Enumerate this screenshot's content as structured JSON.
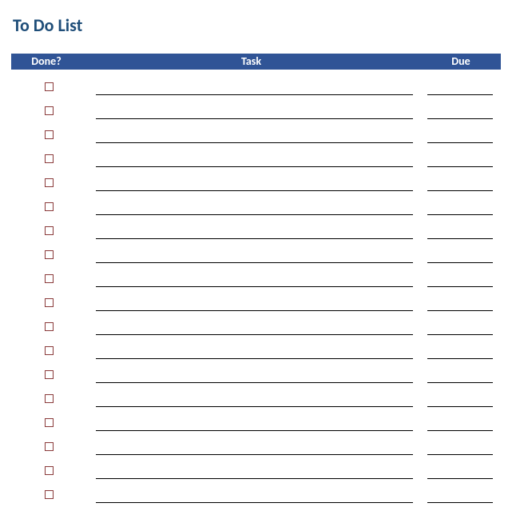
{
  "title": "To Do List",
  "columns": {
    "done": "Done?",
    "task": "Task",
    "due": "Due"
  },
  "rows": [
    {
      "done": false,
      "task": "",
      "due": ""
    },
    {
      "done": false,
      "task": "",
      "due": ""
    },
    {
      "done": false,
      "task": "",
      "due": ""
    },
    {
      "done": false,
      "task": "",
      "due": ""
    },
    {
      "done": false,
      "task": "",
      "due": ""
    },
    {
      "done": false,
      "task": "",
      "due": ""
    },
    {
      "done": false,
      "task": "",
      "due": ""
    },
    {
      "done": false,
      "task": "",
      "due": ""
    },
    {
      "done": false,
      "task": "",
      "due": ""
    },
    {
      "done": false,
      "task": "",
      "due": ""
    },
    {
      "done": false,
      "task": "",
      "due": ""
    },
    {
      "done": false,
      "task": "",
      "due": ""
    },
    {
      "done": false,
      "task": "",
      "due": ""
    },
    {
      "done": false,
      "task": "",
      "due": ""
    },
    {
      "done": false,
      "task": "",
      "due": ""
    },
    {
      "done": false,
      "task": "",
      "due": ""
    },
    {
      "done": false,
      "task": "",
      "due": ""
    },
    {
      "done": false,
      "task": "",
      "due": ""
    }
  ]
}
